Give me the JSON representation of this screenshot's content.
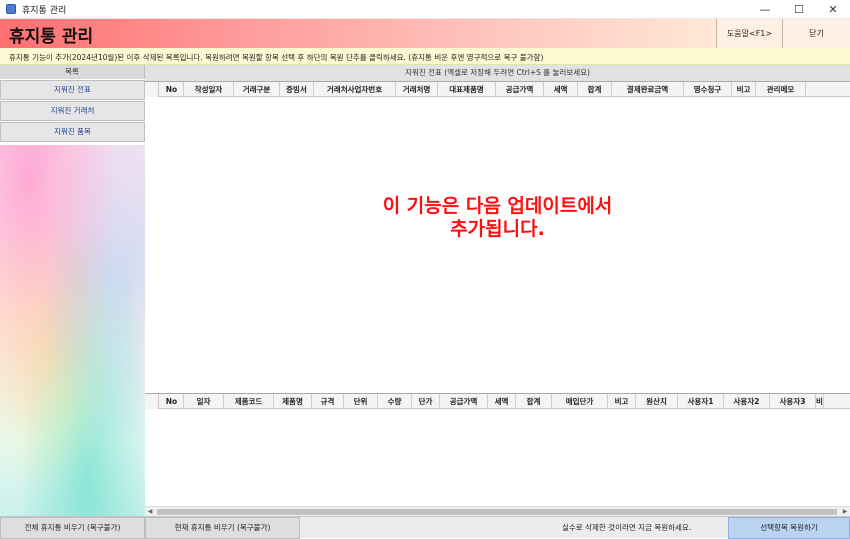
{
  "window": {
    "title": "휴지통 관리",
    "min_label": "—",
    "max_label": "☐",
    "close_label": "✕"
  },
  "header": {
    "title": "휴지통 관리",
    "help_label": "도움말<F1>",
    "close_label": "닫기"
  },
  "notice": "휴지통 기능이 추가(2024년10월)된 이후 삭제된 목록입니다. 복원하려면 복원할 항목 선택 후 하단의 복원 단추를 클릭하세요. (휴지통 비운 후엔 영구적으로 복구 불가함)",
  "sidebar": {
    "header": "목록",
    "items": [
      {
        "label": "지워진 전표"
      },
      {
        "label": "지워진 거래처"
      },
      {
        "label": "지워진 품목"
      }
    ]
  },
  "main": {
    "header": "지워진 전표 (엑셀로 저장해 두려면 Ctrl+S 를 눌러보세요)",
    "top_grid_columns": [
      "No",
      "작성일자",
      "거래구분",
      "증빙서",
      "거래처사업자번호",
      "거래처명",
      "대표제품명",
      "공급가액",
      "세액",
      "합계",
      "결제완료금액",
      "영수청구",
      "비고",
      "관리메모"
    ],
    "bottom_grid_columns": [
      "No",
      "일자",
      "제품코드",
      "제품명",
      "규격",
      "단위",
      "수량",
      "단가",
      "공급가액",
      "세액",
      "합계",
      "매입단가",
      "비고",
      "원산지",
      "사용자1",
      "사용자2",
      "사용자3",
      "비"
    ]
  },
  "overlay": {
    "line1": "이 기능은 다음 업데이트에서",
    "line2": "추가됩니다."
  },
  "footer": {
    "empty_all_label": "전체 휴지통 비우기 (복구불가)",
    "empty_current_label": "현재 휴지통 비우기 (복구불가)",
    "message": "실수로 삭제한 것이라면 지금 복원하세요.",
    "restore_label": "선택항목 복원하기"
  },
  "colors": {
    "accent": "#ff1010",
    "restore_button": "#b9d3f1",
    "notice_bg": "#fdf7d2"
  }
}
